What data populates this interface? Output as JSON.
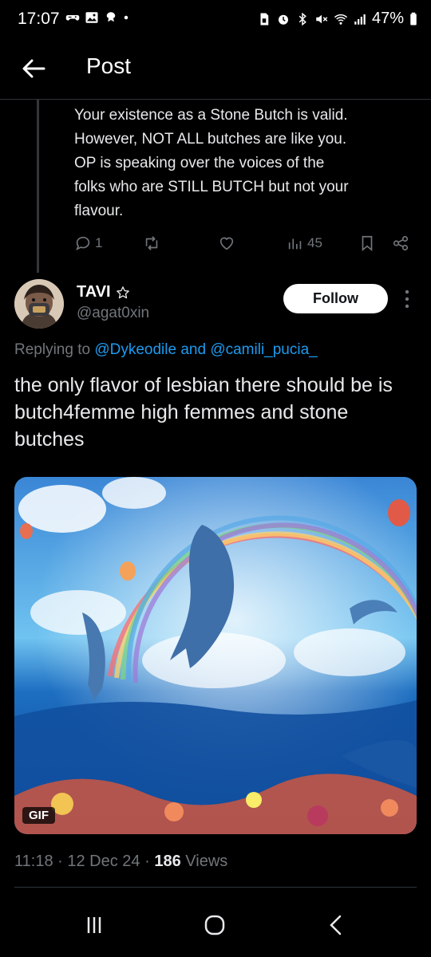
{
  "status_bar": {
    "time": "17:07",
    "battery": "47%",
    "left_icons": [
      "gamepad-icon",
      "gallery-icon",
      "notification-bug-icon",
      "dot-icon"
    ],
    "right_icons": [
      "sim-icon",
      "alarm-icon",
      "bluetooth-icon",
      "mute-icon",
      "wifi-icon",
      "signal-icon",
      "battery-icon"
    ]
  },
  "header": {
    "title": "Post"
  },
  "parent_reply": {
    "text": "Your existence as a Stone Butch is valid.\nHowever, NOT ALL butches are like you.\nOP is speaking over the voices of the\nfolks who are STILL BUTCH but not your\nflavour.",
    "replies": "1",
    "views": "45"
  },
  "post": {
    "display_name": "TAVI",
    "handle": "@agat0xin",
    "follow_label": "Follow",
    "replying_prefix": "Replying to",
    "mention_1": "@Dykeodile",
    "replying_and": "and",
    "mention_2": "@camili_pucia_",
    "text": "the only flavor of lesbian there should be is butch4femme high femmes and stone butches",
    "gif_badge": "GIF",
    "time": "11:18",
    "date": "12 Dec 24",
    "views_count": "186",
    "views_label": "Views"
  },
  "colors": {
    "background": "#000000",
    "text": "#e7e9ea",
    "muted": "#71767b",
    "link": "#1d9bf0",
    "divider": "#2f3336"
  }
}
